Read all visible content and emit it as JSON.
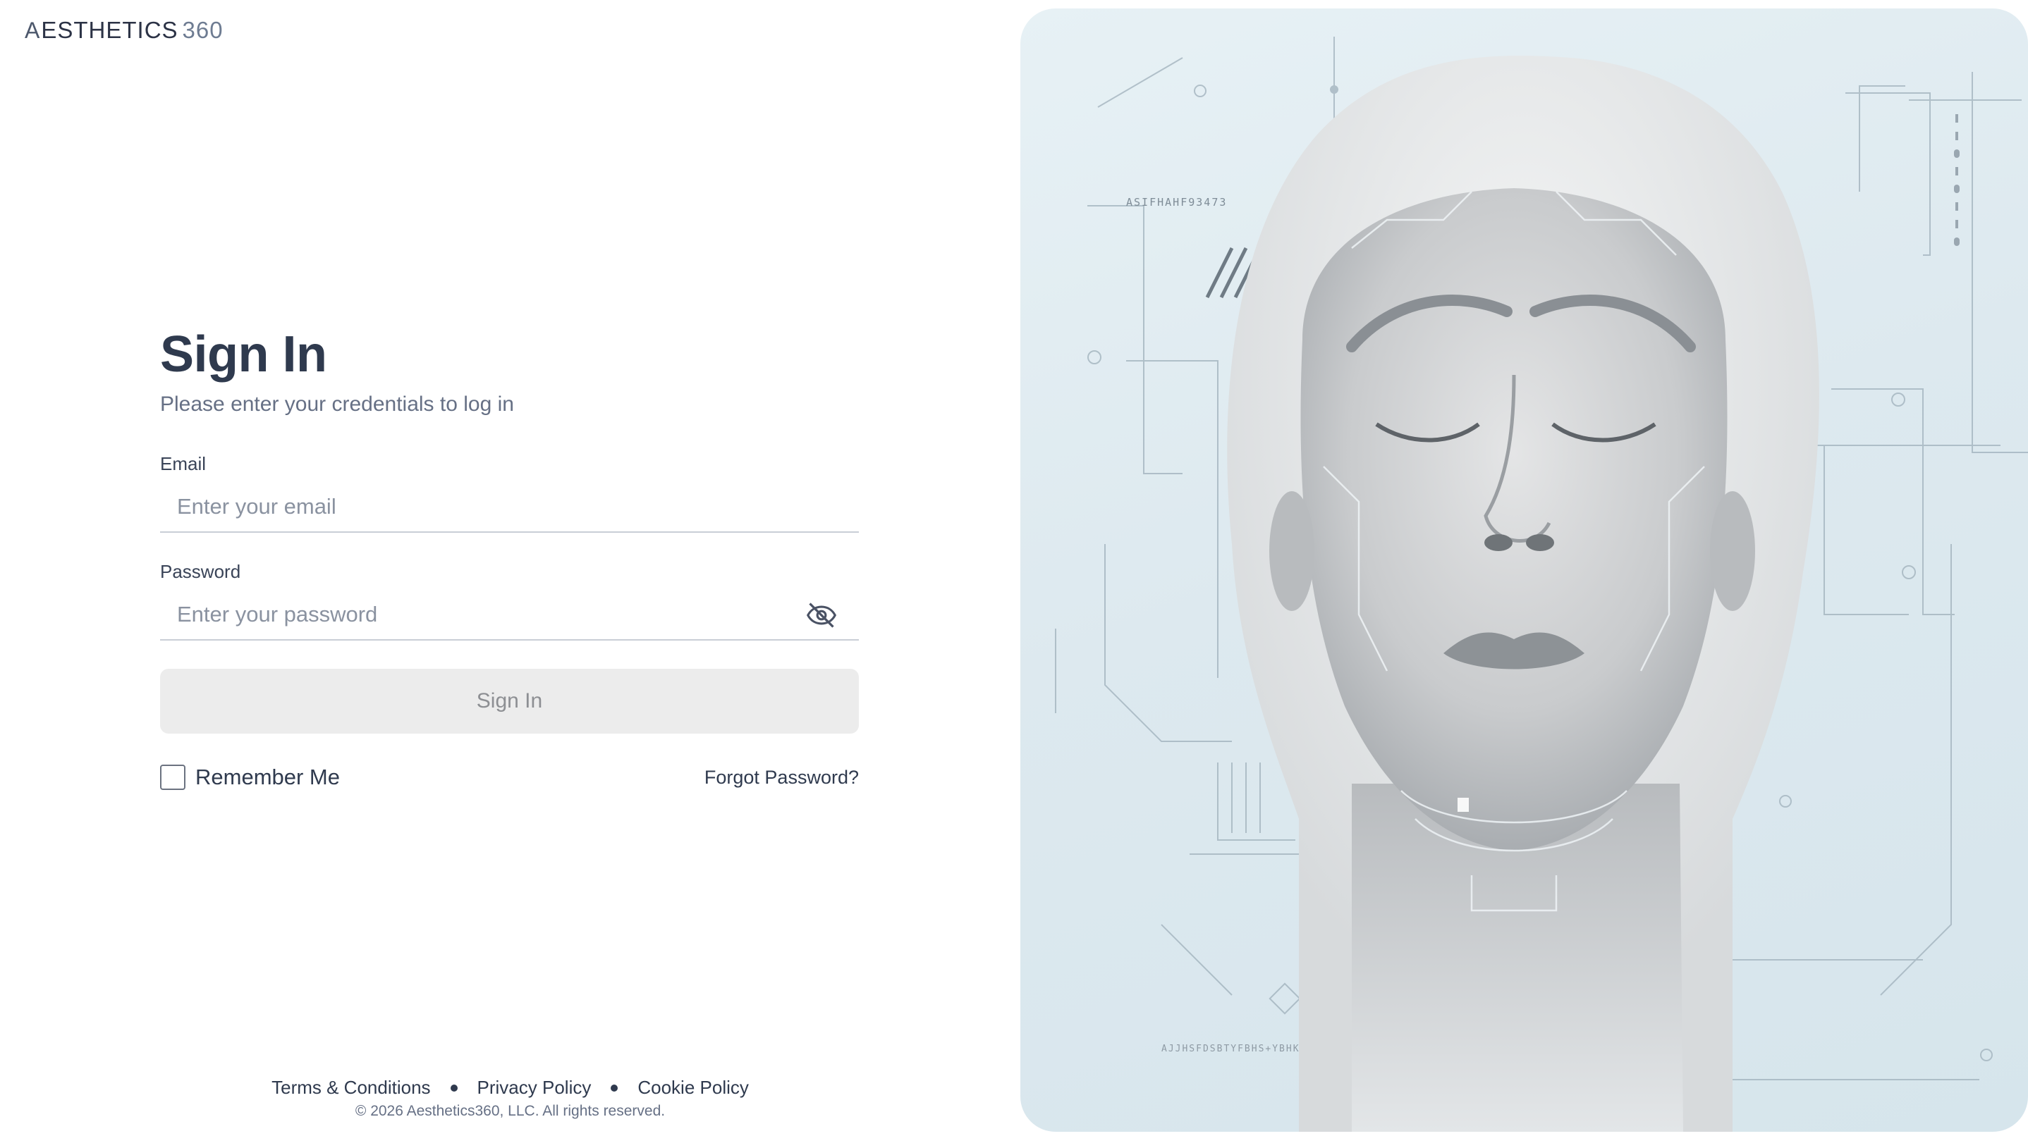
{
  "brand": {
    "logo_mark": "A",
    "logo_word": "ESTHETICS",
    "logo_num": "360"
  },
  "signin": {
    "title": "Sign In",
    "subtitle": "Please enter your credentials to log in",
    "email_label": "Email",
    "email_placeholder": "Enter your email",
    "email_value": "",
    "password_label": "Password",
    "password_placeholder": "Enter your password",
    "password_value": "",
    "password_toggle_icon": "eye-off-icon",
    "submit_label": "Sign In",
    "remember_label": "Remember Me",
    "remember_checked": false,
    "forgot_label": "Forgot Password?"
  },
  "footer": {
    "links": [
      "Terms & Conditions",
      "Privacy Policy",
      "Cookie Policy"
    ],
    "copyright": "© 2026 Aesthetics360, LLC. All rights reserved."
  },
  "hero": {
    "image": "futuristic-face-illustration",
    "overlay_texts": [
      "ASIFHAHF93473",
      "AJJHSFDSBTYFBHS+YBHKS AHFU"
    ]
  },
  "colors": {
    "text": "#2f3a4e",
    "muted": "#667085",
    "button_bg": "#ececec",
    "panel_bg": "#dde9ef"
  }
}
